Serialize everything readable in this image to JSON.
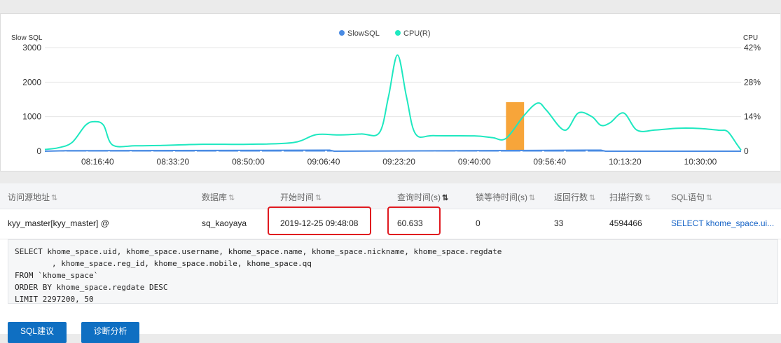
{
  "chart": {
    "left_axis_title": "Slow SQL",
    "right_axis_title": "CPU",
    "legend": [
      {
        "label": "SlowSQL",
        "color": "#4a8be3"
      },
      {
        "label": "CPU(R)",
        "color": "#1ee8c0"
      }
    ]
  },
  "chart_data": {
    "type": "line",
    "title": "",
    "y_left": {
      "label": "Slow SQL",
      "ticks": [
        "3000",
        "2000",
        "1000",
        "0"
      ],
      "range": [
        0,
        3000
      ]
    },
    "y_right": {
      "label": "CPU",
      "ticks": [
        "42%",
        "28%",
        "14%",
        "0"
      ],
      "range": [
        0,
        42
      ]
    },
    "x_ticks": [
      "08:16:40",
      "08:33:20",
      "08:50:00",
      "09:06:40",
      "09:23:20",
      "09:40:00",
      "09:56:40",
      "10:13:20",
      "10:30:00"
    ],
    "x_range": [
      "08:05",
      "10:39"
    ],
    "series": [
      {
        "name": "CPU(R)",
        "axis": "right",
        "color": "#1ee8c0",
        "points": [
          [
            "08:05",
            0.7
          ],
          [
            "08:08",
            1.4
          ],
          [
            "08:11",
            3.5
          ],
          [
            "08:14",
            10.5
          ],
          [
            "08:16",
            12.0
          ],
          [
            "08:18",
            10.5
          ],
          [
            "08:20",
            2.5
          ],
          [
            "08:25",
            2.2
          ],
          [
            "08:30",
            2.3
          ],
          [
            "08:40",
            2.8
          ],
          [
            "08:50",
            2.8
          ],
          [
            "09:00",
            3.5
          ],
          [
            "09:05",
            6.7
          ],
          [
            "09:10",
            6.6
          ],
          [
            "09:15",
            7.0
          ],
          [
            "09:19",
            7.5
          ],
          [
            "09:21",
            22
          ],
          [
            "09:23",
            39.0
          ],
          [
            "09:25",
            22
          ],
          [
            "09:27",
            7.0
          ],
          [
            "09:31",
            6.3
          ],
          [
            "09:40",
            6.2
          ],
          [
            "09:44",
            5.5
          ],
          [
            "09:47",
            5.2
          ],
          [
            "09:51",
            14.5
          ],
          [
            "09:54",
            19.5
          ],
          [
            "09:56",
            16.5
          ],
          [
            "10:00",
            8.5
          ],
          [
            "10:03",
            15.5
          ],
          [
            "10:06",
            14.0
          ],
          [
            "10:08",
            10.5
          ],
          [
            "10:10",
            11.5
          ],
          [
            "10:13",
            15.5
          ],
          [
            "10:16",
            8.5
          ],
          [
            "10:20",
            8.6
          ],
          [
            "10:25",
            9.3
          ],
          [
            "10:30",
            9.2
          ],
          [
            "10:34",
            8.5
          ],
          [
            "10:36",
            8.0
          ],
          [
            "10:38",
            3.0
          ],
          [
            "10:39",
            0.4
          ]
        ]
      },
      {
        "name": "SlowSQL",
        "axis": "left",
        "color": "#4a8be3",
        "points": [
          [
            "08:05",
            0
          ],
          [
            "08:10",
            15
          ],
          [
            "09:08",
            30
          ],
          [
            "09:09",
            0
          ],
          [
            "10:05",
            30
          ],
          [
            "10:08",
            30
          ],
          [
            "10:09",
            0
          ],
          [
            "10:39",
            0
          ]
        ]
      }
    ],
    "highlight": {
      "from": "09:47",
      "to": "09:51",
      "color": "#f7a53a"
    }
  },
  "table": {
    "columns": [
      {
        "label": "访问源地址",
        "sort": "⇅",
        "active": false
      },
      {
        "label": "数据库",
        "sort": "⇅",
        "active": false
      },
      {
        "label": "开始时间",
        "sort": "⇅",
        "active": false
      },
      {
        "label": "查询时间(s)",
        "sort": "⇅",
        "active": true
      },
      {
        "label": "锁等待时间(s)",
        "sort": "⇅",
        "active": false
      },
      {
        "label": "返回行数",
        "sort": "⇅",
        "active": false
      },
      {
        "label": "扫描行数",
        "sort": "⇅",
        "active": false
      },
      {
        "label": "SQL语句",
        "sort": "⇅",
        "active": false
      }
    ],
    "row": {
      "source": "kyy_master[kyy_master] @",
      "database": "sq_kaoyaya",
      "start_time": "2019-12-25 09:48:08",
      "query_time": "60.633",
      "lock_wait": "0",
      "rows_returned": "33",
      "rows_scanned": "4594466",
      "sql": "SELECT khome_space.ui..."
    }
  },
  "sql_detail": "SELECT khome_space.uid, khome_space.username, khome_space.name, khome_space.nickname, khome_space.regdate\n\t, khome_space.reg_id, khome_space.mobile, khome_space.qq\nFROM `khome_space`\nORDER BY khome_space.regdate DESC\nLIMIT 2297200, 50",
  "buttons": {
    "sql_advice": "SQL建议",
    "diagnose": "诊断分析"
  },
  "colors": {
    "accent": "#0f6fc2",
    "highlight_box": "#e0191f"
  }
}
